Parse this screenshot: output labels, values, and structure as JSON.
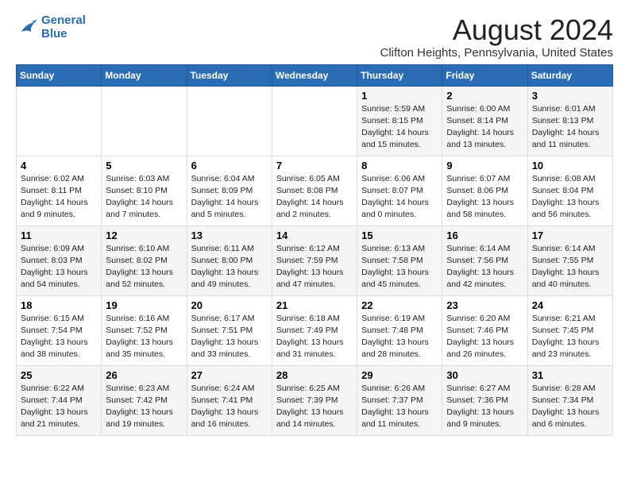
{
  "logo": {
    "line1": "General",
    "line2": "Blue"
  },
  "title": "August 2024",
  "subtitle": "Clifton Heights, Pennsylvania, United States",
  "headers": [
    "Sunday",
    "Monday",
    "Tuesday",
    "Wednesday",
    "Thursday",
    "Friday",
    "Saturday"
  ],
  "weeks": [
    [
      {
        "num": "",
        "info": ""
      },
      {
        "num": "",
        "info": ""
      },
      {
        "num": "",
        "info": ""
      },
      {
        "num": "",
        "info": ""
      },
      {
        "num": "1",
        "info": "Sunrise: 5:59 AM\nSunset: 8:15 PM\nDaylight: 14 hours\nand 15 minutes."
      },
      {
        "num": "2",
        "info": "Sunrise: 6:00 AM\nSunset: 8:14 PM\nDaylight: 14 hours\nand 13 minutes."
      },
      {
        "num": "3",
        "info": "Sunrise: 6:01 AM\nSunset: 8:13 PM\nDaylight: 14 hours\nand 11 minutes."
      }
    ],
    [
      {
        "num": "4",
        "info": "Sunrise: 6:02 AM\nSunset: 8:11 PM\nDaylight: 14 hours\nand 9 minutes."
      },
      {
        "num": "5",
        "info": "Sunrise: 6:03 AM\nSunset: 8:10 PM\nDaylight: 14 hours\nand 7 minutes."
      },
      {
        "num": "6",
        "info": "Sunrise: 6:04 AM\nSunset: 8:09 PM\nDaylight: 14 hours\nand 5 minutes."
      },
      {
        "num": "7",
        "info": "Sunrise: 6:05 AM\nSunset: 8:08 PM\nDaylight: 14 hours\nand 2 minutes."
      },
      {
        "num": "8",
        "info": "Sunrise: 6:06 AM\nSunset: 8:07 PM\nDaylight: 14 hours\nand 0 minutes."
      },
      {
        "num": "9",
        "info": "Sunrise: 6:07 AM\nSunset: 8:06 PM\nDaylight: 13 hours\nand 58 minutes."
      },
      {
        "num": "10",
        "info": "Sunrise: 6:08 AM\nSunset: 8:04 PM\nDaylight: 13 hours\nand 56 minutes."
      }
    ],
    [
      {
        "num": "11",
        "info": "Sunrise: 6:09 AM\nSunset: 8:03 PM\nDaylight: 13 hours\nand 54 minutes."
      },
      {
        "num": "12",
        "info": "Sunrise: 6:10 AM\nSunset: 8:02 PM\nDaylight: 13 hours\nand 52 minutes."
      },
      {
        "num": "13",
        "info": "Sunrise: 6:11 AM\nSunset: 8:00 PM\nDaylight: 13 hours\nand 49 minutes."
      },
      {
        "num": "14",
        "info": "Sunrise: 6:12 AM\nSunset: 7:59 PM\nDaylight: 13 hours\nand 47 minutes."
      },
      {
        "num": "15",
        "info": "Sunrise: 6:13 AM\nSunset: 7:58 PM\nDaylight: 13 hours\nand 45 minutes."
      },
      {
        "num": "16",
        "info": "Sunrise: 6:14 AM\nSunset: 7:56 PM\nDaylight: 13 hours\nand 42 minutes."
      },
      {
        "num": "17",
        "info": "Sunrise: 6:14 AM\nSunset: 7:55 PM\nDaylight: 13 hours\nand 40 minutes."
      }
    ],
    [
      {
        "num": "18",
        "info": "Sunrise: 6:15 AM\nSunset: 7:54 PM\nDaylight: 13 hours\nand 38 minutes."
      },
      {
        "num": "19",
        "info": "Sunrise: 6:16 AM\nSunset: 7:52 PM\nDaylight: 13 hours\nand 35 minutes."
      },
      {
        "num": "20",
        "info": "Sunrise: 6:17 AM\nSunset: 7:51 PM\nDaylight: 13 hours\nand 33 minutes."
      },
      {
        "num": "21",
        "info": "Sunrise: 6:18 AM\nSunset: 7:49 PM\nDaylight: 13 hours\nand 31 minutes."
      },
      {
        "num": "22",
        "info": "Sunrise: 6:19 AM\nSunset: 7:48 PM\nDaylight: 13 hours\nand 28 minutes."
      },
      {
        "num": "23",
        "info": "Sunrise: 6:20 AM\nSunset: 7:46 PM\nDaylight: 13 hours\nand 26 minutes."
      },
      {
        "num": "24",
        "info": "Sunrise: 6:21 AM\nSunset: 7:45 PM\nDaylight: 13 hours\nand 23 minutes."
      }
    ],
    [
      {
        "num": "25",
        "info": "Sunrise: 6:22 AM\nSunset: 7:44 PM\nDaylight: 13 hours\nand 21 minutes."
      },
      {
        "num": "26",
        "info": "Sunrise: 6:23 AM\nSunset: 7:42 PM\nDaylight: 13 hours\nand 19 minutes."
      },
      {
        "num": "27",
        "info": "Sunrise: 6:24 AM\nSunset: 7:41 PM\nDaylight: 13 hours\nand 16 minutes."
      },
      {
        "num": "28",
        "info": "Sunrise: 6:25 AM\nSunset: 7:39 PM\nDaylight: 13 hours\nand 14 minutes."
      },
      {
        "num": "29",
        "info": "Sunrise: 6:26 AM\nSunset: 7:37 PM\nDaylight: 13 hours\nand 11 minutes."
      },
      {
        "num": "30",
        "info": "Sunrise: 6:27 AM\nSunset: 7:36 PM\nDaylight: 13 hours\nand 9 minutes."
      },
      {
        "num": "31",
        "info": "Sunrise: 6:28 AM\nSunset: 7:34 PM\nDaylight: 13 hours\nand 6 minutes."
      }
    ]
  ]
}
